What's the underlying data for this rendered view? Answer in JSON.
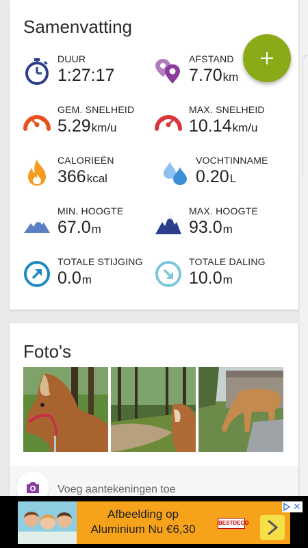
{
  "summary": {
    "title": "Samenvatting",
    "stats": [
      {
        "id": "duration",
        "label": "DUUR",
        "value": "1:27:17",
        "unit": "",
        "icon": "stopwatch-icon"
      },
      {
        "id": "distance",
        "label": "AFSTAND",
        "value": "7.70",
        "unit": "km",
        "icon": "map-pins-icon"
      },
      {
        "id": "avg-speed",
        "label": "GEM. SNELHEID",
        "value": "5.29",
        "unit": "km/u",
        "icon": "speedometer-avg-icon"
      },
      {
        "id": "max-speed",
        "label": "MAX. SNELHEID",
        "value": "10.14",
        "unit": "km/u",
        "icon": "speedometer-max-icon"
      },
      {
        "id": "calories",
        "label": "CALORIEËN",
        "value": "366",
        "unit": "kcal",
        "icon": "flame-icon"
      },
      {
        "id": "hydration",
        "label": "VOCHTINNAME",
        "value": "0.20",
        "unit": "L",
        "icon": "water-drops-icon"
      },
      {
        "id": "min-altitude",
        "label": "MIN. HOOGTE",
        "value": "67.0",
        "unit": "m",
        "icon": "mountain-low-icon"
      },
      {
        "id": "max-altitude",
        "label": "MAX. HOOGTE",
        "value": "93.0",
        "unit": "m",
        "icon": "mountain-high-icon"
      },
      {
        "id": "total-ascent",
        "label": "TOTALE STIJGING",
        "value": "0.0",
        "unit": "m",
        "icon": "ascent-arrow-icon"
      },
      {
        "id": "total-descent",
        "label": "TOTALE DALING",
        "value": "10.0",
        "unit": "m",
        "icon": "descent-arrow-icon"
      }
    ]
  },
  "fab": {
    "icon": "plus-icon"
  },
  "photos": {
    "title": "Foto's",
    "items": [
      {
        "name": "photo-horse-halter"
      },
      {
        "name": "photo-forest-path"
      },
      {
        "name": "photo-horse-grazing"
      }
    ]
  },
  "notes": {
    "placeholder": "Voeg aantekeningen toe",
    "icon": "camera-icon"
  },
  "ad": {
    "line1": "Afbeelding op",
    "line2": "Aluminium Nu €6,30",
    "brand": "BESTDECO",
    "close": "✕"
  },
  "colors": {
    "accent_fab": "#8aab17",
    "navy": "#2b3f8c",
    "purple": "#8a3c9c",
    "orange_red": "#e8501e",
    "red": "#d8373c",
    "flame": "#f59b1f",
    "water": "#3a8fd8",
    "teal": "#1f8ac0",
    "light_teal": "#79c7d8"
  }
}
